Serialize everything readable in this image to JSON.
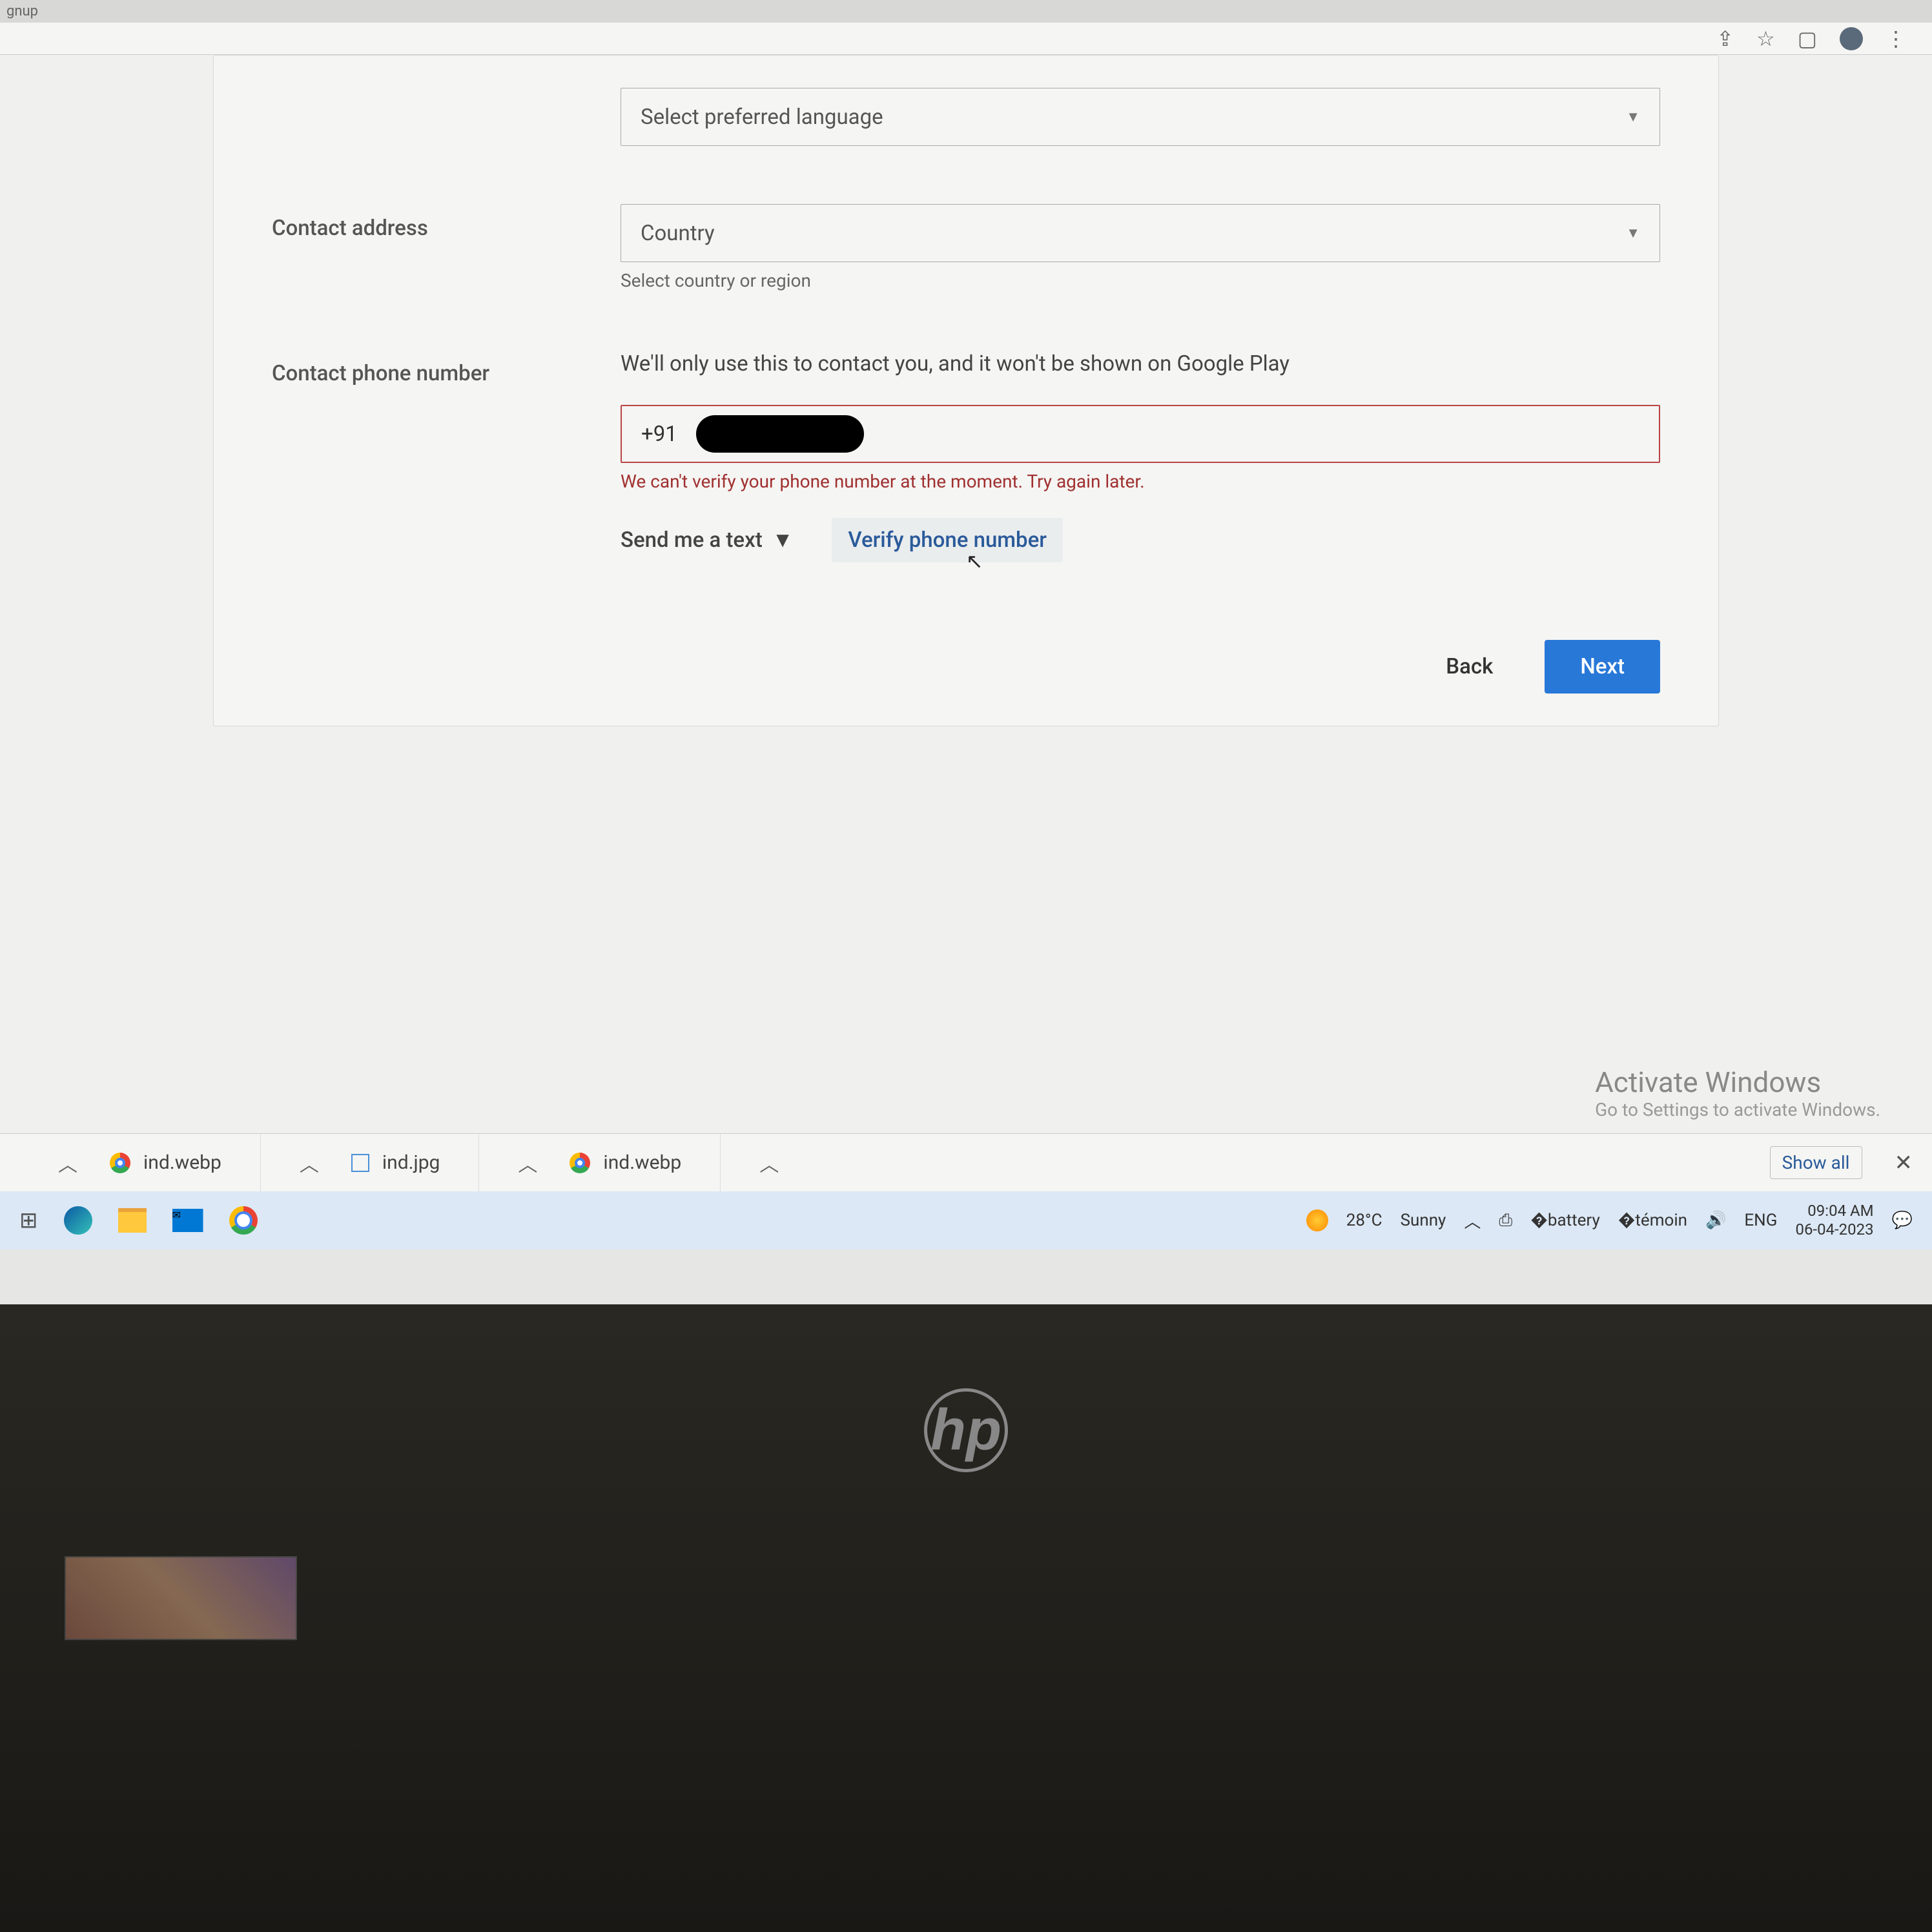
{
  "browser": {
    "tab_fragment": "gnup"
  },
  "form": {
    "language": {
      "placeholder": "Select preferred language"
    },
    "contact_address": {
      "label": "Contact address",
      "placeholder": "Country",
      "helper": "Select country or region"
    },
    "contact_phone": {
      "label": "Contact phone number",
      "description": "We'll only use this to contact you, and it won't be shown on Google Play",
      "value": "+91",
      "error": "We can't verify your phone number at the moment. Try again later.",
      "send_method": "Send me a text",
      "verify_button": "Verify phone number"
    },
    "back_button": "Back",
    "next_button": "Next"
  },
  "watermark": {
    "title": "Activate Windows",
    "subtitle": "Go to Settings to activate Windows."
  },
  "downloads": {
    "items": [
      {
        "name": "ind.webp",
        "icon": "chrome"
      },
      {
        "name": "ind.jpg",
        "icon": "image"
      },
      {
        "name": "ind.webp",
        "icon": "chrome"
      }
    ],
    "show_all": "Show all"
  },
  "taskbar": {
    "weather_temp": "28°C",
    "weather_cond": "Sunny",
    "lang": "ENG",
    "time": "09:04 AM",
    "date": "06-04-2023"
  }
}
